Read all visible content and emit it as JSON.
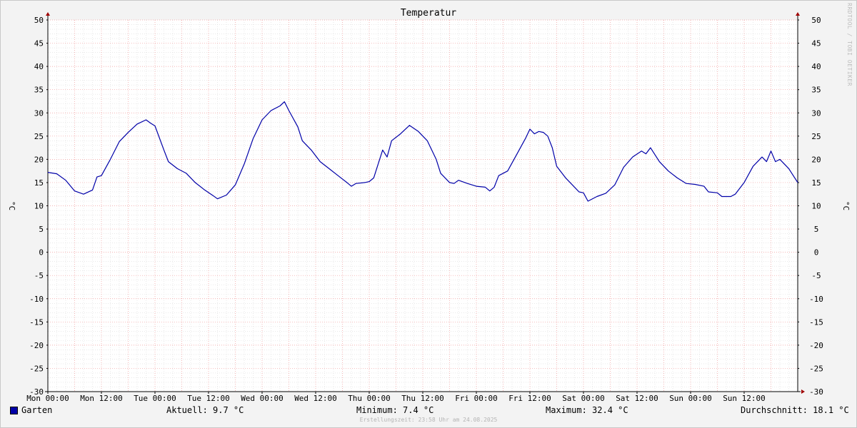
{
  "title": "Temperatur",
  "watermark": "RRDTOOL / TOBI OETIKER",
  "legend": {
    "series_name": "Garten",
    "current": "Aktuell: 9.7 °C",
    "minimum": "Minimum: 7.4 °C",
    "maximum": "Maximum: 32.4 °C",
    "average": "Durchschnitt: 18.1 °C",
    "color": "#0000a8"
  },
  "footer": "Erstellungszeit: 23:58 Uhr am 24.08.2025",
  "chart_data": {
    "type": "line",
    "title": "Temperatur",
    "ylabel": "°C",
    "ylim": [
      -30,
      50
    ],
    "y_ticks": [
      "50",
      "45",
      "40",
      "35",
      "30",
      "25",
      "20",
      "15",
      "10",
      "5",
      "0",
      "-5",
      "-10",
      "-15",
      "-20",
      "-25",
      "-30"
    ],
    "x_ticks": [
      "Mon 00:00",
      "Mon 12:00",
      "Tue 00:00",
      "Tue 12:00",
      "Wed 00:00",
      "Wed 12:00",
      "Thu 00:00",
      "Thu 12:00",
      "Fri 00:00",
      "Fri 12:00",
      "Sat 00:00",
      "Sat 12:00",
      "Sun 00:00",
      "Sun 12:00"
    ],
    "xlim_hours": [
      0,
      168
    ],
    "grid": true,
    "series": [
      {
        "name": "Garten",
        "color": "#0000a8",
        "points": [
          [
            0,
            17.2
          ],
          [
            2,
            16.9
          ],
          [
            4,
            15.5
          ],
          [
            6,
            13.2
          ],
          [
            8,
            12.5
          ],
          [
            10,
            13.4
          ],
          [
            11,
            16.2
          ],
          [
            12,
            16.5
          ],
          [
            14,
            20
          ],
          [
            16,
            23.8
          ],
          [
            18,
            25.8
          ],
          [
            20,
            27.6
          ],
          [
            22,
            28.5
          ],
          [
            23,
            27.8
          ],
          [
            24,
            27.2
          ],
          [
            26,
            22
          ],
          [
            27,
            19.5
          ],
          [
            29,
            18
          ],
          [
            31,
            17
          ],
          [
            33,
            15
          ],
          [
            35,
            13.5
          ],
          [
            37,
            12.2
          ],
          [
            38,
            11.5
          ],
          [
            40,
            12.3
          ],
          [
            42,
            14.5
          ],
          [
            44,
            19
          ],
          [
            46,
            24.5
          ],
          [
            48,
            28.5
          ],
          [
            50,
            30.5
          ],
          [
            52,
            31.5
          ],
          [
            53,
            32.4
          ],
          [
            54,
            30.5
          ],
          [
            56,
            27
          ],
          [
            57,
            24
          ],
          [
            59,
            22
          ],
          [
            61,
            19.5
          ],
          [
            63,
            18
          ],
          [
            65,
            16.5
          ],
          [
            67,
            15
          ],
          [
            68,
            14.2
          ],
          [
            69,
            14.8
          ],
          [
            71,
            15
          ],
          [
            72,
            15.2
          ],
          [
            73,
            16
          ],
          [
            74,
            19
          ],
          [
            75,
            22
          ],
          [
            76,
            20.5
          ],
          [
            77,
            24
          ],
          [
            79,
            25.5
          ],
          [
            81,
            27.3
          ],
          [
            83,
            26
          ],
          [
            85,
            24
          ],
          [
            87,
            20
          ],
          [
            88,
            17
          ],
          [
            90,
            15
          ],
          [
            91,
            14.8
          ],
          [
            92,
            15.5
          ],
          [
            94,
            14.8
          ],
          [
            96,
            14.2
          ],
          [
            98,
            14
          ],
          [
            99,
            13.2
          ],
          [
            100,
            14
          ],
          [
            101,
            16.5
          ],
          [
            103,
            17.5
          ],
          [
            105,
            21
          ],
          [
            107,
            24.5
          ],
          [
            108,
            26.5
          ],
          [
            109,
            25.5
          ],
          [
            110,
            26
          ],
          [
            111,
            25.8
          ],
          [
            112,
            25
          ],
          [
            113,
            22.5
          ],
          [
            114,
            18.5
          ],
          [
            116,
            16
          ],
          [
            118,
            14
          ],
          [
            119,
            13
          ],
          [
            120,
            12.8
          ],
          [
            121,
            11
          ],
          [
            123,
            12
          ],
          [
            125,
            12.7
          ],
          [
            127,
            14.5
          ],
          [
            129,
            18.3
          ],
          [
            131,
            20.5
          ],
          [
            133,
            21.8
          ],
          [
            134,
            21.2
          ],
          [
            135,
            22.5
          ],
          [
            137,
            19.5
          ],
          [
            139,
            17.5
          ],
          [
            141,
            16
          ],
          [
            143,
            14.8
          ],
          [
            145,
            14.6
          ],
          [
            147,
            14.2
          ],
          [
            148,
            13
          ],
          [
            150,
            12.8
          ],
          [
            151,
            12
          ],
          [
            153,
            12
          ],
          [
            154,
            12.5
          ],
          [
            156,
            15
          ],
          [
            158,
            18.5
          ],
          [
            159,
            19.5
          ],
          [
            160,
            20.5
          ],
          [
            161,
            19.5
          ],
          [
            162,
            21.8
          ],
          [
            163,
            19.5
          ],
          [
            164,
            20
          ],
          [
            166,
            18
          ],
          [
            168,
            15
          ]
        ]
      }
    ]
  }
}
